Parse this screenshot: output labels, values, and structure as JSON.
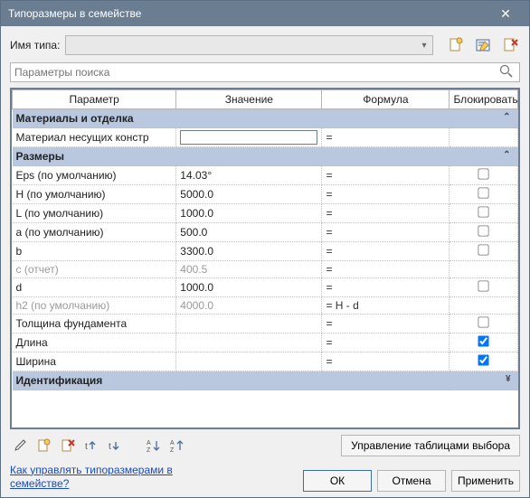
{
  "window": {
    "title": "Типоразмеры в семействе"
  },
  "type_row": {
    "label": "Имя типа:",
    "value": "",
    "icon_new": "new",
    "icon_rename": "rename",
    "icon_delete": "delete"
  },
  "search": {
    "placeholder": "Параметры поиска"
  },
  "columns": {
    "param": "Параметр",
    "value": "Значение",
    "formula": "Формула",
    "lock": "Блокировать"
  },
  "groups": [
    {
      "title": "Материалы и отделка",
      "collapsed": false,
      "rows": [
        {
          "param": "Материал несущих констр",
          "value": "",
          "formula": "=",
          "lock": null,
          "editable_value": true
        }
      ]
    },
    {
      "title": "Размеры",
      "collapsed": false,
      "rows": [
        {
          "param": "Eps (по умолчанию)",
          "value": "14.03°",
          "formula": "=",
          "lock": false
        },
        {
          "param": "H (по умолчанию)",
          "value": "5000.0",
          "formula": "=",
          "lock": false
        },
        {
          "param": "L (по умолчанию)",
          "value": "1000.0",
          "formula": "=",
          "lock": false
        },
        {
          "param": "a (по умолчанию)",
          "value": "500.0",
          "formula": "=",
          "lock": false
        },
        {
          "param": "b",
          "value": "3300.0",
          "formula": "=",
          "lock": false
        },
        {
          "param": "c (отчет)",
          "value": "400.5",
          "formula": "=",
          "lock": null,
          "muted": true
        },
        {
          "param": "d",
          "value": "1000.0",
          "formula": "=",
          "lock": false
        },
        {
          "param": "h2 (по умолчанию)",
          "value": "4000.0",
          "formula": "= H - d",
          "lock": null,
          "muted": true
        },
        {
          "param": "Толщина фундамента",
          "value": "",
          "formula": "=",
          "lock": false
        },
        {
          "param": "Длина",
          "value": "",
          "formula": "=",
          "lock": true
        },
        {
          "param": "Ширина",
          "value": "",
          "formula": "=",
          "lock": true
        }
      ]
    },
    {
      "title": "Идентификация",
      "collapsed": true,
      "rows": []
    }
  ],
  "toolbar": {
    "manage_tables": "Управление таблицами выбора"
  },
  "footer": {
    "help_link": "Как управлять типоразмерами в семействе?",
    "ok": "ОК",
    "cancel": "Отмена",
    "apply": "Применить"
  }
}
